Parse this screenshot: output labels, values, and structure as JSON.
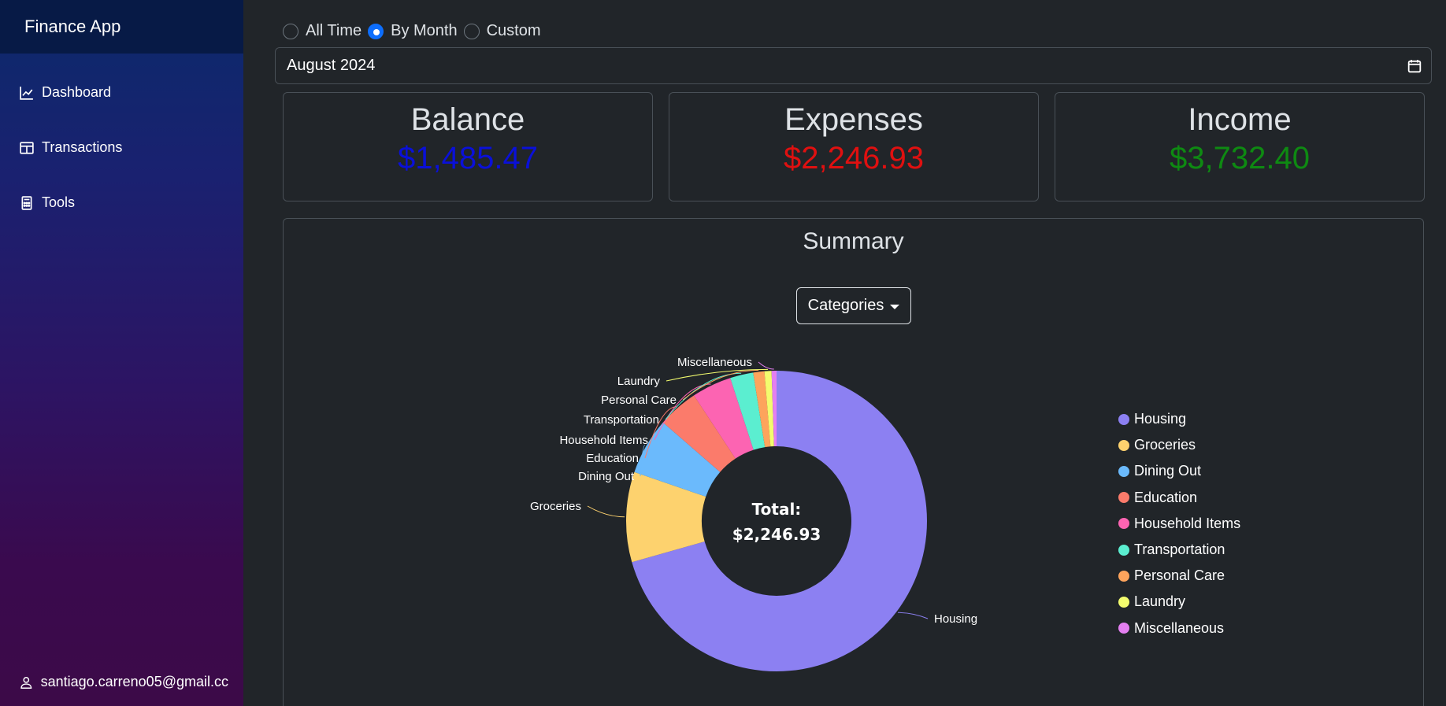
{
  "app": {
    "title": "Finance App"
  },
  "sidebar": {
    "items": [
      {
        "label": "Dashboard",
        "icon": "line-chart-icon"
      },
      {
        "label": "Transactions",
        "icon": "table-icon"
      },
      {
        "label": "Tools",
        "icon": "calculator-icon"
      }
    ],
    "user_email": "santiago.carreno05@gmail.cc"
  },
  "filters": {
    "options": [
      "All Time",
      "By Month",
      "Custom"
    ],
    "selected": "By Month",
    "month_value": "August 2024"
  },
  "cards": {
    "balance": {
      "title": "Balance",
      "value": "$1,485.47",
      "color": "#0a10d9"
    },
    "expenses": {
      "title": "Expenses",
      "value": "$2,246.93",
      "color": "#e01010"
    },
    "income": {
      "title": "Income",
      "value": "$3,732.40",
      "color": "#0e8a12"
    }
  },
  "summary": {
    "title": "Summary",
    "dropdown_label": "Categories",
    "center_label": "Total:",
    "center_value": "$2,246.93"
  },
  "chart_data": {
    "type": "pie",
    "categories": [
      "Housing",
      "Groceries",
      "Dining Out",
      "Education",
      "Household Items",
      "Transportation",
      "Personal Care",
      "Laundry",
      "Miscellaneous"
    ],
    "values": [
      1586.0,
      218.0,
      137.0,
      98.0,
      96.0,
      56.0,
      27.0,
      17.0,
      11.93
    ],
    "colors": [
      "#8c80f2",
      "#fdd26e",
      "#6bbafc",
      "#fb7b6b",
      "#fc64b2",
      "#5beed0",
      "#fda45c",
      "#f3fc6e",
      "#e47ff0"
    ],
    "legend_position": "right"
  }
}
